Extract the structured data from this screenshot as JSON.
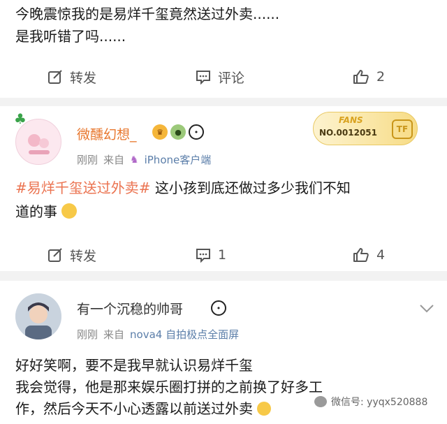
{
  "posts": [
    {
      "text_lines": [
        "今晚震惊我的是易烊千玺竟然送过外卖......",
        "是我听错了吗......"
      ],
      "actions": {
        "repost": "转发",
        "comment": "评论",
        "like": "2"
      }
    },
    {
      "username": "微醺幻想_",
      "badge": {
        "label": "FANS",
        "number": "NO.0012051",
        "logo": "TF"
      },
      "meta": {
        "time": "刚刚",
        "from": "来自",
        "device": "iPhone客户端"
      },
      "hashtag": "#易烊千玺送过外卖#",
      "text_line1_rest": " 这小孩到底还做过多少我们不知",
      "text_line2": "道的事",
      "actions": {
        "repost": "转发",
        "comment": "1",
        "like": "4"
      }
    },
    {
      "username": "有一个沉稳的帅哥",
      "meta": {
        "time": "刚刚",
        "from": "来自",
        "device": "nova4 自拍极点全面屏"
      },
      "text_lines": [
        "好好笑啊，要不是我早就认识易烊千玺",
        "我会觉得，他是那来娱乐圈打拼的之前换了好多工",
        "作，然后今天不小心透露以前送过外卖"
      ]
    }
  ],
  "watermark": "微信号: yyqx520888",
  "colors": {
    "accent": "#eb7350",
    "username_orange": "#e8772e",
    "device_blue": "#5b7ea9"
  },
  "icons": [
    "repost-icon",
    "comment-icon",
    "like-icon",
    "crown-emoji-icon",
    "frog-emoji-icon",
    "panda-emoji-icon",
    "clover-icon",
    "chevron-down-icon",
    "wechat-icon",
    "unicorn-icon"
  ]
}
